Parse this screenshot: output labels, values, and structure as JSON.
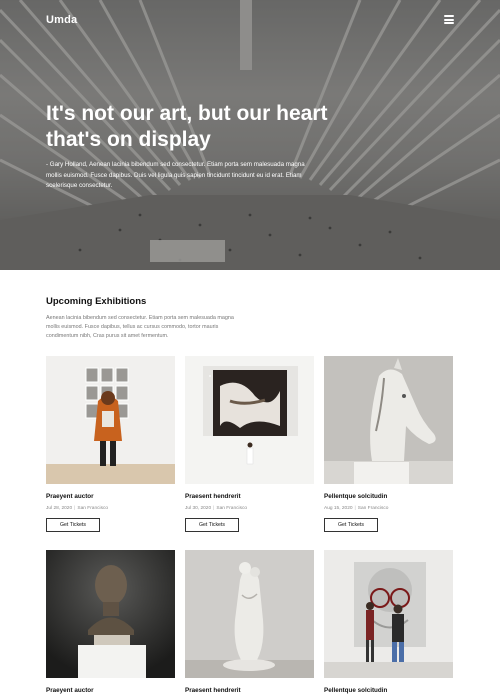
{
  "brand": {
    "name": "Umda"
  },
  "hero": {
    "title": "It's not our art, but our heart that's on display",
    "text": "- Gary Holland,  Aenean lacinia bibendum sed consectetur. Etiam porta sem malesuada magna mollis euismod. Fusce dapibus. Duis vel ligula quis sapien tincidunt tincidunt eu id erat. Etiam scelerisque consectetur."
  },
  "section": {
    "title": "Upcoming Exhibitions",
    "description": "Aenean lacinia bibendum sed consectetur. Etiam porta sem malesuada magna mollis euismod. Fusce dapibus, tellus ac cursus commodo, tortor mauris condimentum nibh, Cras purus sit amet fermentum."
  },
  "exhibitions": [
    {
      "title": "Praeyent auctor",
      "date": "Jul 28, 2020",
      "location": "San Francisco",
      "button": "Get Tickets"
    },
    {
      "title": "Praesent hendrerit",
      "date": "Jul 30, 2020",
      "location": "San Francisco",
      "button": "Get Tickets"
    },
    {
      "title": "Pellentque solcitudin",
      "date": "Aug 15, 2020",
      "location": "San Francisco",
      "button": "Get Tickets"
    },
    {
      "title": "Praeyent auctor"
    },
    {
      "title": "Praesent hendrerit"
    },
    {
      "title": "Pellentque solcitudin"
    }
  ]
}
